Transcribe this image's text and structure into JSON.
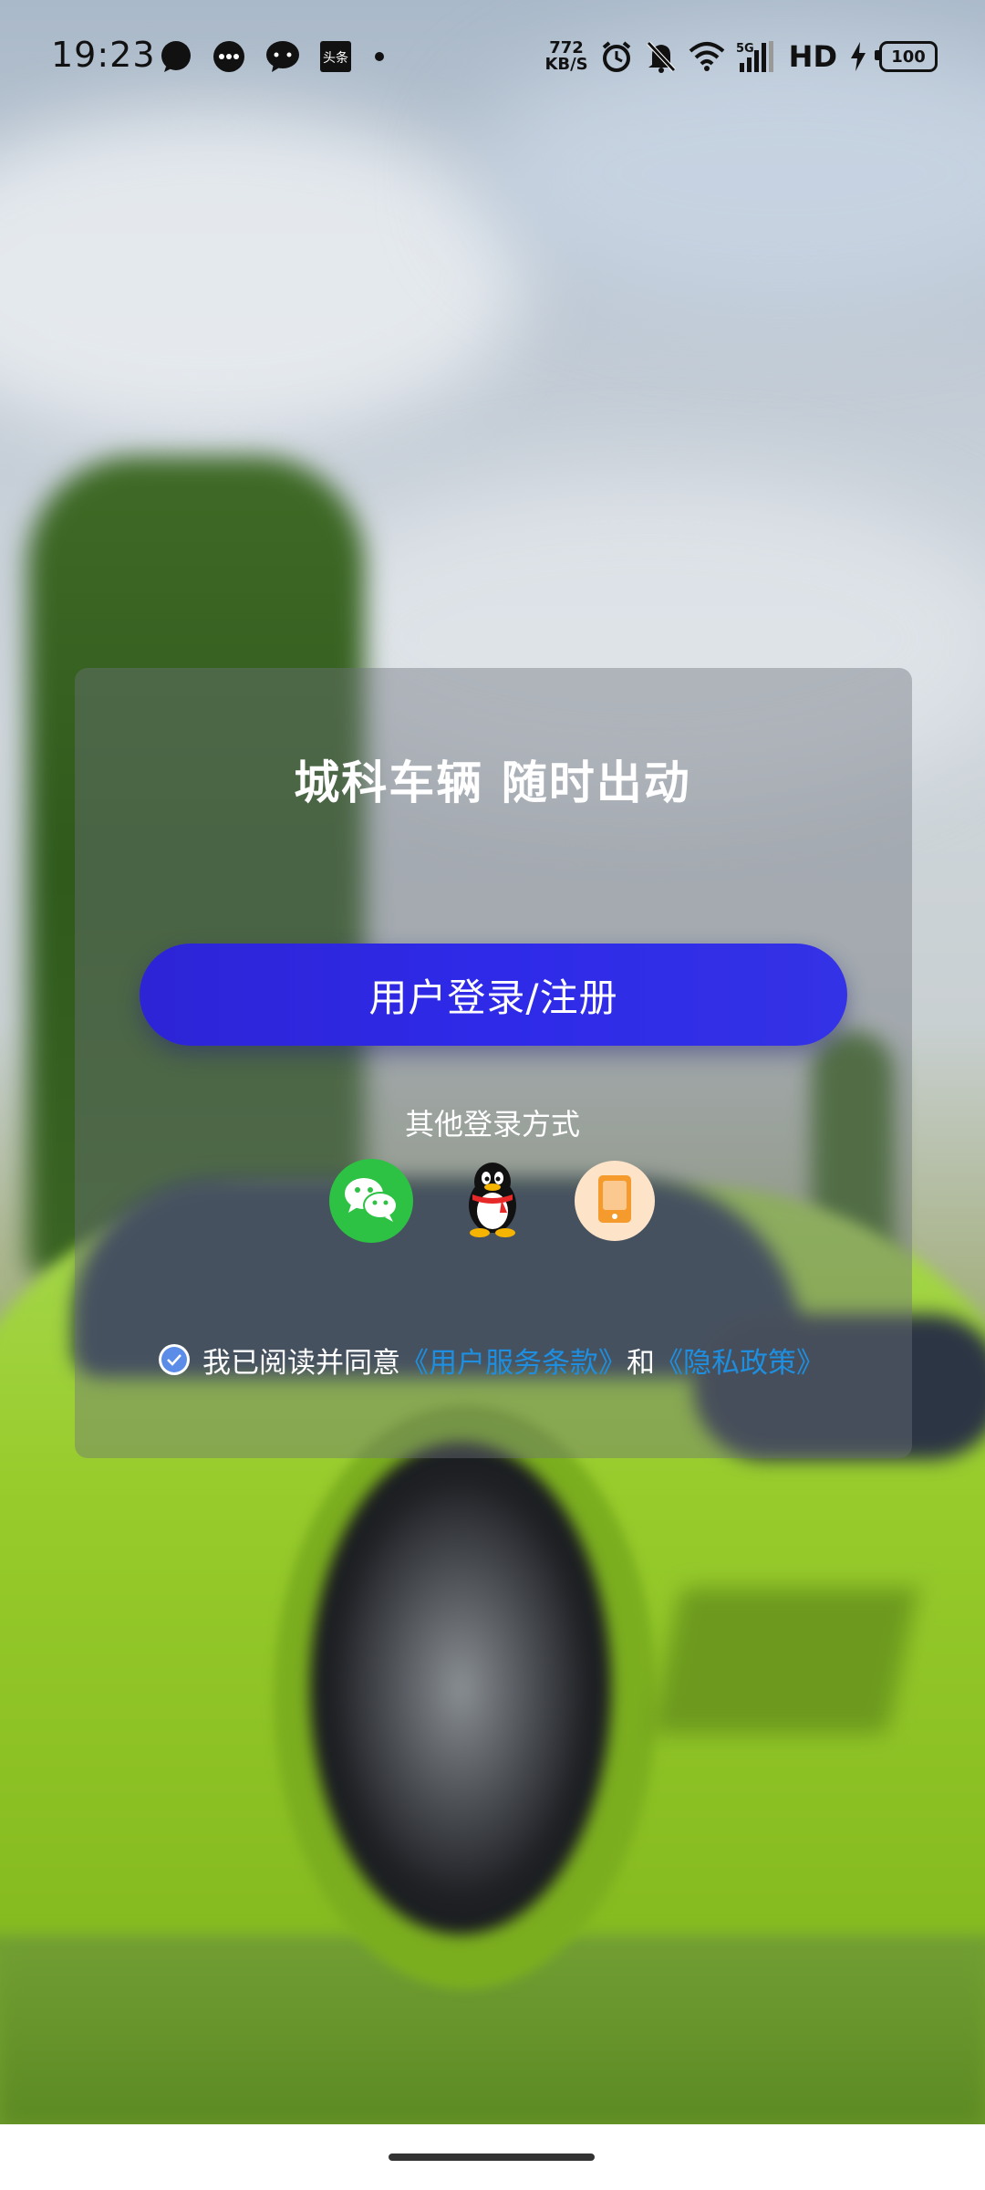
{
  "status_bar": {
    "time": "19:23",
    "net_speed_value": "772",
    "net_speed_unit": "KB/S",
    "network": "5G",
    "hd": "HD",
    "battery": "100",
    "notification_icons": [
      "chat-bubble-icon",
      "message-dots-icon",
      "chat-icon",
      "toutiao-icon",
      "dot-icon"
    ],
    "toutiao_label": "头条",
    "system_icons": [
      "alarm-icon",
      "mute-bell-icon",
      "wifi-icon",
      "signal-icon",
      "charging-icon",
      "battery-icon"
    ]
  },
  "login": {
    "title": "城科车辆 随时出动",
    "primary_button": "用户登录/注册",
    "other_methods_label": "其他登录方式",
    "methods": [
      {
        "name": "wechat",
        "icon": "wechat-icon",
        "color": "#2dc243"
      },
      {
        "name": "qq",
        "icon": "qq-penguin-icon"
      },
      {
        "name": "phone",
        "icon": "phone-icon",
        "color": "#f59a2c"
      }
    ]
  },
  "agreement": {
    "checked": true,
    "prefix": "我已阅读并同意",
    "terms_link": "《用户服务条款》",
    "conjunction": "和",
    "privacy_link": "《隐私政策》"
  },
  "colors": {
    "primary_button": "#2e2ae8",
    "link": "#1e8fe0",
    "checkbox": "#5b8de8"
  }
}
